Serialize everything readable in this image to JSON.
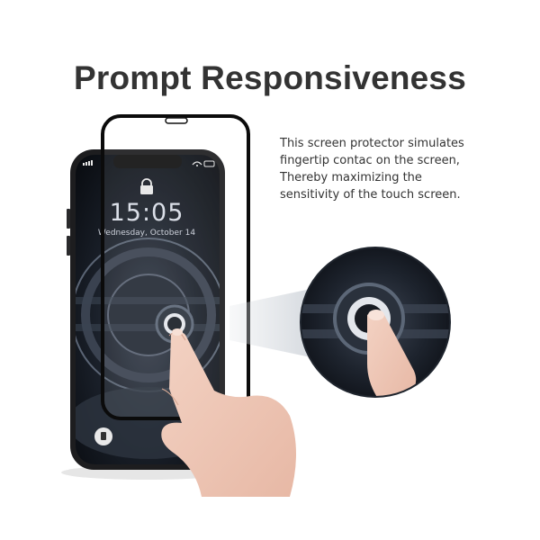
{
  "heading": "Prompt Responsiveness",
  "description": {
    "lines": [
      "This screen protector simulates",
      "fingertip contac on the screen,",
      "Thereby maximizing the",
      "sensitivity of the touch screen."
    ]
  },
  "phone": {
    "time": "15:05",
    "date": "Wednesday, October 14"
  },
  "icons": {
    "lock": "lock-icon",
    "flashlight": "flashlight-icon",
    "fingerprint": "fingerprint-icon",
    "signal": "signal-icon",
    "wifi": "wifi-icon",
    "battery": "battery-icon"
  },
  "colors": {
    "text": "#333333",
    "protector_edge": "#0b0b0b",
    "screen_dark": "#1a1f29"
  }
}
